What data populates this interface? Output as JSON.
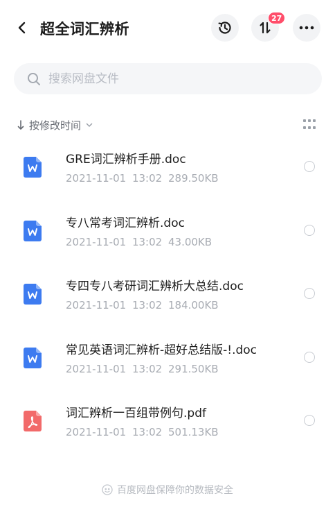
{
  "header": {
    "title": "超全词汇辨析",
    "transfer_badge": "27"
  },
  "search": {
    "placeholder": "搜索网盘文件"
  },
  "sort": {
    "label": "按修改时间"
  },
  "files": [
    {
      "name": "GRE词汇辨析手册.doc",
      "date": "2021-11-01",
      "time": "13:02",
      "size": "289.50KB",
      "type": "word"
    },
    {
      "name": "专八常考词汇辨析.doc",
      "date": "2021-11-01",
      "time": "13:02",
      "size": "43.00KB",
      "type": "word"
    },
    {
      "name": "专四专八考研词汇辨析大总结.doc",
      "date": "2021-11-01",
      "time": "13:02",
      "size": "184.00KB",
      "type": "word"
    },
    {
      "name": "常见英语词汇辨析-超好总结版-!.doc",
      "date": "2021-11-01",
      "time": "13:02",
      "size": "291.50KB",
      "type": "word"
    },
    {
      "name": "词汇辨析一百组带例句.pdf",
      "date": "2021-11-01",
      "time": "13:02",
      "size": "501.13KB",
      "type": "pdf"
    }
  ],
  "footer": {
    "text": "百度网盘保障你的数据安全"
  },
  "colors": {
    "word_icon": "#3d7bf0",
    "pdf_icon": "#f26a6a",
    "badge": "#ff4d6a"
  }
}
